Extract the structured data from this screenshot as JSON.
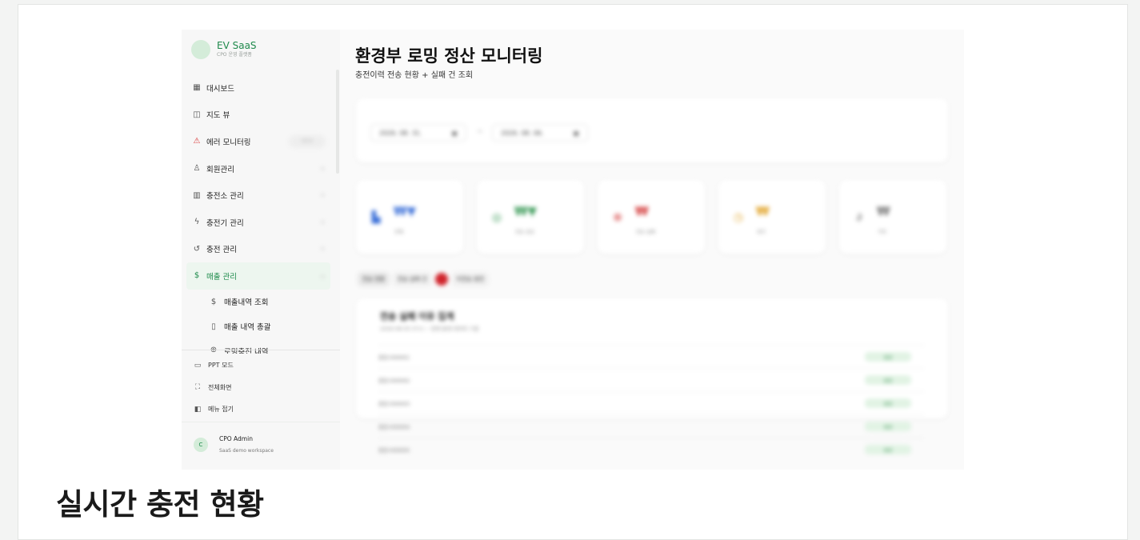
{
  "brand": {
    "name": "EV SaaS",
    "subtitle": "CPO 운영 플랫폼"
  },
  "sidebar": {
    "items": [
      {
        "label": "대시보드",
        "icon": "grid-icon"
      },
      {
        "label": "지도 뷰",
        "icon": "map-icon"
      },
      {
        "label": "에러 모니터링",
        "icon": "warning-icon",
        "badge": "NEW"
      },
      {
        "label": "회원관리",
        "icon": "users-icon"
      },
      {
        "label": "충전소 관리",
        "icon": "building-icon"
      },
      {
        "label": "충전기 관리",
        "icon": "bolt-icon"
      },
      {
        "label": "충전 관리",
        "icon": "history-icon"
      },
      {
        "label": "매출 관리",
        "icon": "dollar-icon"
      }
    ],
    "sub_items": [
      {
        "label": "매출내역 조회",
        "icon": "dollar-icon"
      },
      {
        "label": "매출 내역 총괄",
        "icon": "document-icon"
      },
      {
        "label": "로밍충전 내역",
        "icon": "globe-icon"
      }
    ],
    "bottom": [
      {
        "label": "PPT 모드",
        "icon": "monitor-icon"
      },
      {
        "label": "전체화면",
        "icon": "fullscreen-icon"
      },
      {
        "label": "메뉴 접기",
        "icon": "collapse-icon"
      }
    ],
    "user": {
      "initial": "C",
      "name": "CPO Admin",
      "workspace": "SaaS demo workspace"
    }
  },
  "page": {
    "title": "환경부 로밍 정산 모니터링",
    "subtitle": "충전이력 전송 현황 + 실패 건 조회"
  },
  "filters": {
    "start_date": "2026. 08. 31.",
    "end_date": "2026. 08. 06."
  },
  "kpis": [
    {
      "value": "₩▼",
      "label": "전체",
      "color": "#3a6fd8",
      "icon": "chart-icon"
    },
    {
      "value": "₩▼",
      "label": "전송 성공",
      "color": "#3a9a58",
      "icon": "check-circle-icon"
    },
    {
      "value": "₩",
      "label": "전송 실패",
      "color": "#d33a3a",
      "icon": "x-circle-icon"
    },
    {
      "value": "₩",
      "label": "대기",
      "color": "#e0a021",
      "icon": "clock-icon"
    },
    {
      "value": "₩",
      "label": "기타",
      "color": "#777777",
      "icon": "link-icon"
    }
  ],
  "tabs": [
    {
      "label": "전송 현황"
    },
    {
      "label": "전송 실패 건"
    },
    {
      "label": "미전송 충전"
    }
  ],
  "table": {
    "title": "전송 실패 이유 집계",
    "subtitle": "2026-08-05 07시 ~ 현재 통계 데이터 기준",
    "rows": [
      {
        "id": "충전-000001",
        "status": "성공"
      },
      {
        "id": "충전-000002",
        "status": "성공"
      },
      {
        "id": "충전-000003",
        "status": "성공"
      },
      {
        "id": "충전-000004",
        "status": "성공"
      },
      {
        "id": "충전-000005",
        "status": "성공"
      }
    ]
  },
  "caption": "실시간 충전 현황"
}
